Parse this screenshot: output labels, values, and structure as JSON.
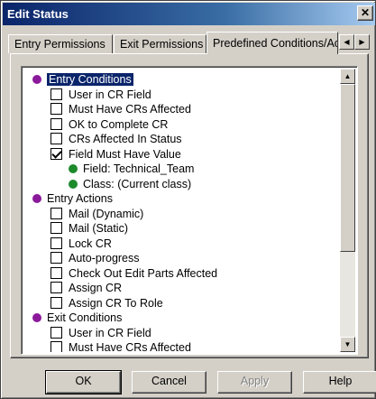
{
  "window": {
    "title": "Edit Status",
    "close_glyph": "✕"
  },
  "tabs": [
    {
      "label": "Entry Permissions",
      "active": false
    },
    {
      "label": "Exit Permissions",
      "active": false
    },
    {
      "label": "Predefined Conditions/Actions",
      "active": true
    }
  ],
  "tab_scroll": {
    "left_glyph": "◀",
    "right_glyph": "▶"
  },
  "tree": {
    "items": [
      {
        "kind": "group",
        "label": "Entry Conditions",
        "selected": true,
        "level": 0
      },
      {
        "kind": "checkbox",
        "label": "User in CR Field",
        "checked": false,
        "level": 1
      },
      {
        "kind": "checkbox",
        "label": "Must Have CRs Affected",
        "checked": false,
        "level": 1
      },
      {
        "kind": "checkbox",
        "label": "OK to Complete CR",
        "checked": false,
        "level": 1
      },
      {
        "kind": "checkbox",
        "label": "CRs Affected In Status",
        "checked": false,
        "level": 1
      },
      {
        "kind": "checkbox",
        "label": "Field Must Have Value",
        "checked": true,
        "level": 1
      },
      {
        "kind": "detail",
        "label": "Field: Technical_Team",
        "level": 2
      },
      {
        "kind": "detail",
        "label": "Class: (Current class)",
        "level": 2
      },
      {
        "kind": "group",
        "label": "Entry Actions",
        "selected": false,
        "level": 0
      },
      {
        "kind": "checkbox",
        "label": "Mail (Dynamic)",
        "checked": false,
        "level": 1
      },
      {
        "kind": "checkbox",
        "label": "Mail (Static)",
        "checked": false,
        "level": 1
      },
      {
        "kind": "checkbox",
        "label": "Lock CR",
        "checked": false,
        "level": 1
      },
      {
        "kind": "checkbox",
        "label": "Auto-progress",
        "checked": false,
        "level": 1
      },
      {
        "kind": "checkbox",
        "label": "Check Out Edit Parts Affected",
        "checked": false,
        "level": 1
      },
      {
        "kind": "checkbox",
        "label": "Assign CR",
        "checked": false,
        "level": 1
      },
      {
        "kind": "checkbox",
        "label": "Assign CR To Role",
        "checked": false,
        "level": 1
      },
      {
        "kind": "group",
        "label": "Exit Conditions",
        "selected": false,
        "level": 0
      },
      {
        "kind": "checkbox",
        "label": "User in CR Field",
        "checked": false,
        "level": 1
      },
      {
        "kind": "checkbox",
        "label": "Must Have CRs Affected",
        "checked": false,
        "level": 1
      }
    ],
    "group_dot_color": "#8b1a9b",
    "detail_dot_color": "#1d8a2c"
  },
  "scrollbar": {
    "up_glyph": "▲",
    "down_glyph": "▼"
  },
  "buttons": {
    "ok": "OK",
    "cancel": "Cancel",
    "apply": "Apply",
    "help": "Help"
  }
}
